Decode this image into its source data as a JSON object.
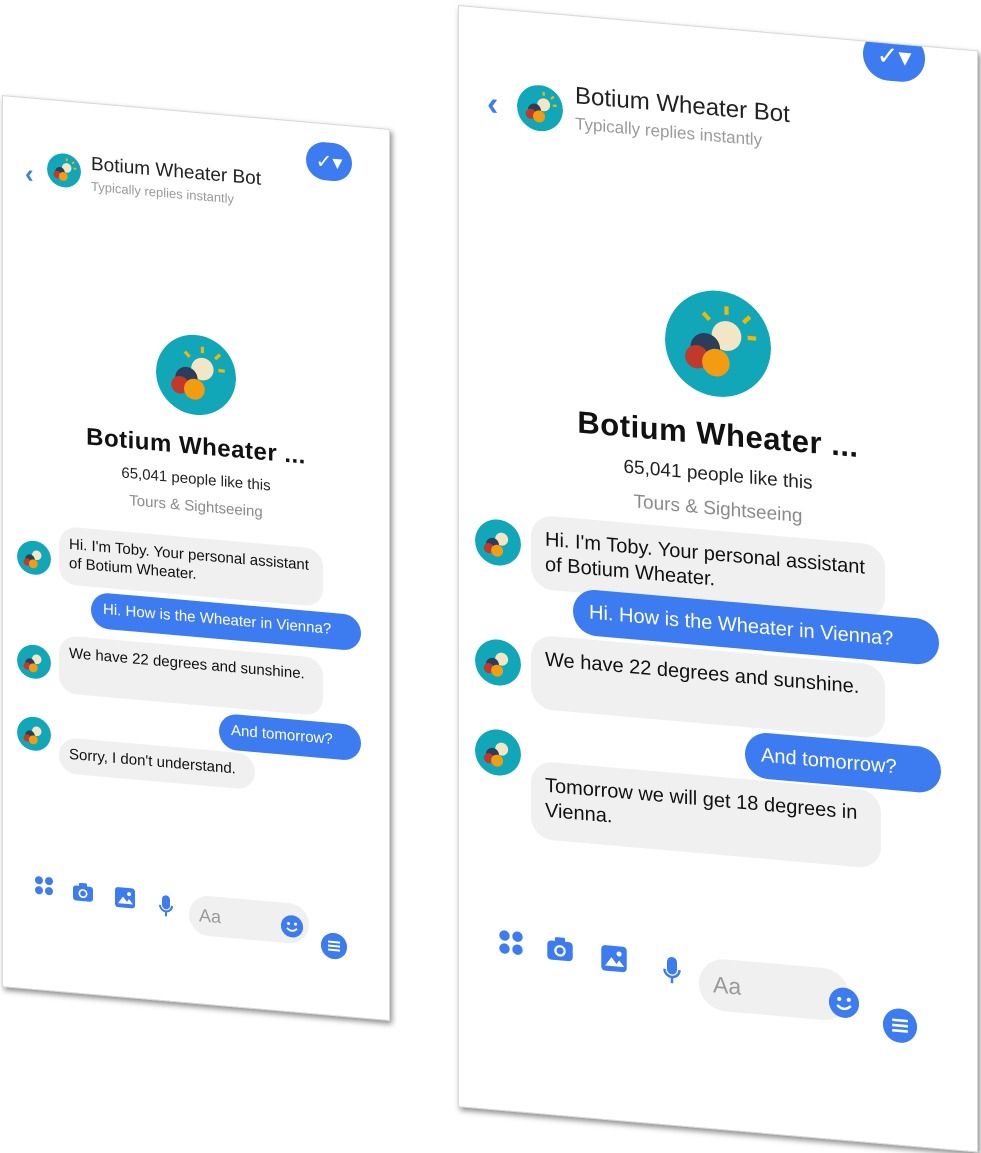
{
  "colors": {
    "accent": "#3d7bf0",
    "bubble_bot": "#f0f0f0",
    "avatar_bg": "#12a7b8"
  },
  "header": {
    "title": "Botium Wheater Bot",
    "subtitle": "Typically replies instantly"
  },
  "profile": {
    "name": "Botium Wheater ...",
    "likes": "65,041 people like this",
    "category": "Tours & Sightseeing"
  },
  "left_chat": {
    "messages": [
      {
        "from": "bot",
        "text": "Hi. I'm Toby. Your personal assistant of Botium Wheater."
      },
      {
        "from": "user",
        "text": "Hi. How is the Wheater in Vienna?"
      },
      {
        "from": "bot",
        "text": "We have 22 degrees and sunshine."
      },
      {
        "from": "user",
        "text": "And tomorrow?"
      },
      {
        "from": "bot",
        "text": "Sorry, I don't understand."
      }
    ]
  },
  "right_chat": {
    "messages": [
      {
        "from": "bot",
        "text": "Hi. I'm Toby. Your personal assistant of Botium Wheater."
      },
      {
        "from": "user",
        "text": "Hi. How is the Wheater in Vienna?"
      },
      {
        "from": "bot",
        "text": "We have 22 degrees and sunshine."
      },
      {
        "from": "user",
        "text": "And tomorrow?"
      },
      {
        "from": "bot",
        "text": "Tomorrow we will get 18 degrees in Vienna."
      }
    ]
  },
  "composer": {
    "placeholder": "Aa"
  },
  "icons": {
    "back": "chevron-left-icon",
    "check": "check-dropdown-icon",
    "apps": "apps-grid-icon",
    "camera": "camera-icon",
    "image": "image-icon",
    "mic": "microphone-icon",
    "emoji": "emoji-icon",
    "menu": "menu-icon"
  }
}
